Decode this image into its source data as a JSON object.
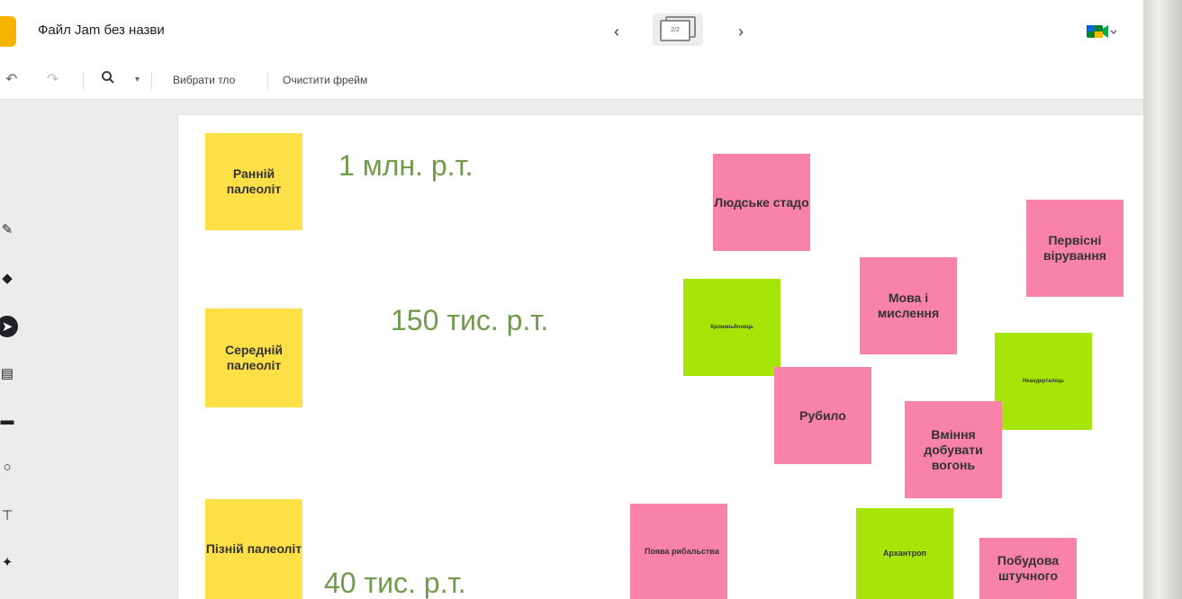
{
  "header": {
    "file_title": "Файл Jam без назви",
    "prev_icon": "chevron-left-icon",
    "next_icon": "chevron-right-icon",
    "frame_indicator": "2/2",
    "meet_icon": "google-meet-icon"
  },
  "toolbar": {
    "undo_icon": "undo-icon",
    "redo_icon": "redo-icon",
    "zoom_icon": "zoom-icon",
    "choose_background": "Вибрати тло",
    "clear_frame": "Очистити фрейм"
  },
  "side_tools": [
    "pen-icon",
    "eraser-icon",
    "select-icon",
    "sticky-note-icon",
    "image-icon",
    "shape-icon",
    "text-box-icon",
    "laser-icon"
  ],
  "canvas": {
    "eras": [
      {
        "label": "Ранній палеоліт",
        "date": "1 млн. р.т."
      },
      {
        "label": "Середній палеоліт",
        "date": "150 тис. р.т."
      },
      {
        "label": "Пізній палеоліт",
        "date": "40 тис. р.т."
      }
    ],
    "notes": {
      "human_herd": "Людське стадо",
      "primitive_beliefs": "Первісні вірування",
      "language": "Мова і мислення",
      "cro_magnon": "Кроманьйонець",
      "neanderthal": "Неандерталець",
      "chopper": "Рубило",
      "fire": "Вміння добувати вогонь",
      "fishing": "Поява рибальства",
      "archanthropus": "Архантроп",
      "building": "Побудова штучного"
    }
  },
  "colors": {
    "yellow_note": "#fde046",
    "pink_note": "#f982a8",
    "green_note": "#a7e408",
    "era_text": "#6f9b4a"
  }
}
